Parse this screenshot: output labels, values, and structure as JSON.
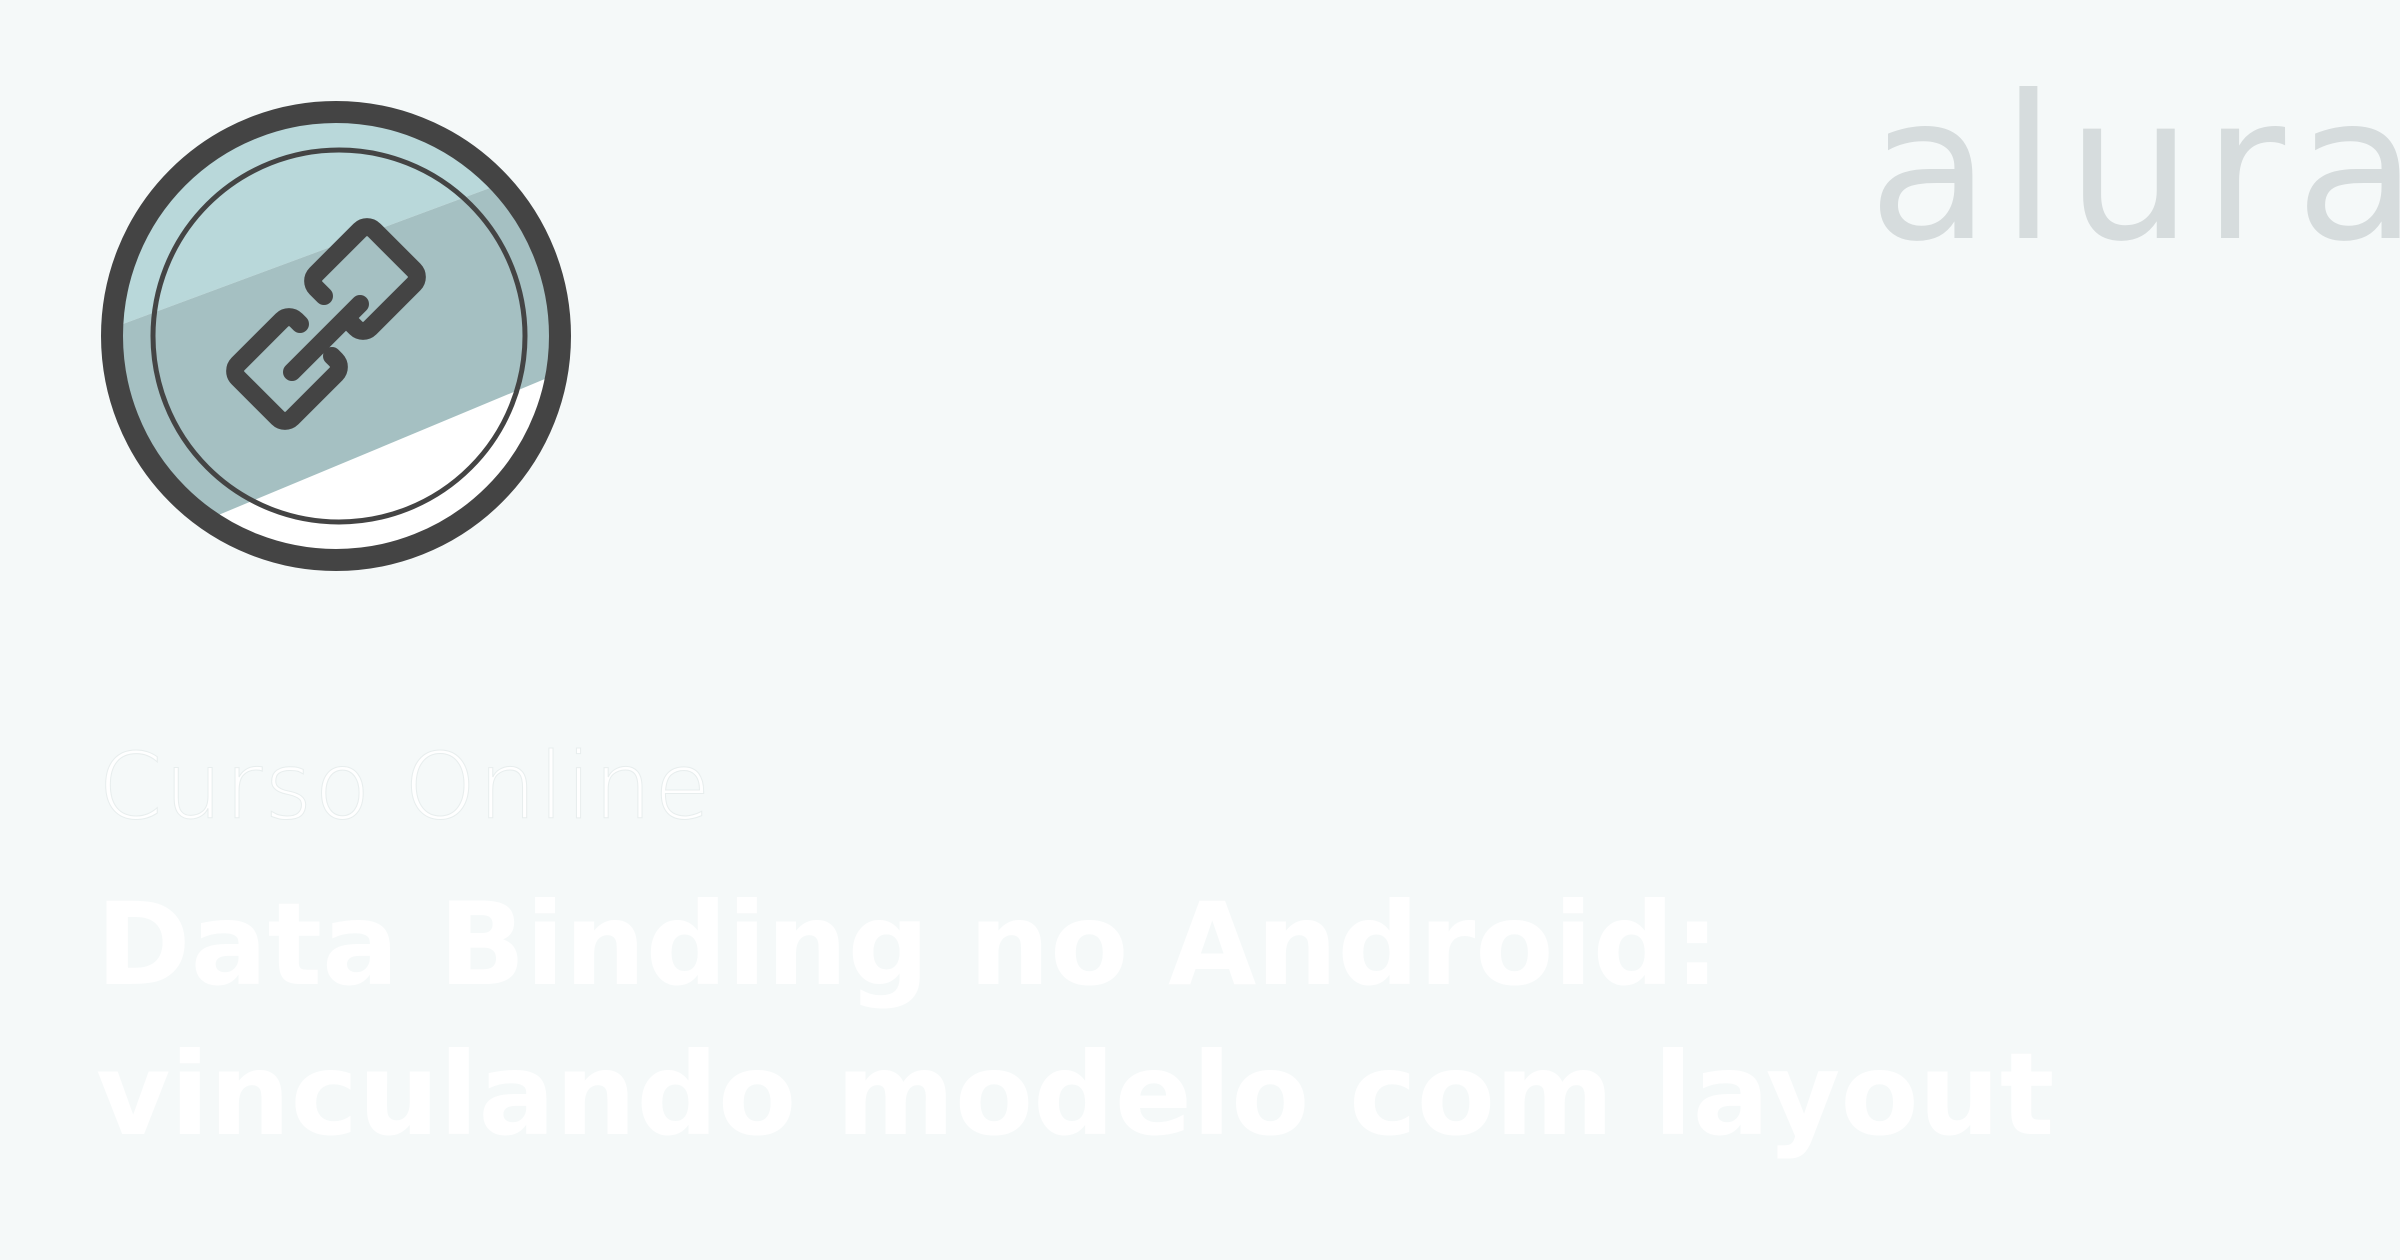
{
  "brand": {
    "name": "alura"
  },
  "badge": {
    "icon": "link-icon"
  },
  "course": {
    "label": "Curso Online",
    "title_line_1": "Data Binding no Android:",
    "title_line_2": "vinculando modelo com layout"
  },
  "colors": {
    "background": "#f5f9f9",
    "badge_ring": "#444444",
    "badge_fill_light": "#b9d8da",
    "badge_fill_dark": "#a5c0c2",
    "logo": "#d6dcdd",
    "title_text": "#ffffff"
  }
}
